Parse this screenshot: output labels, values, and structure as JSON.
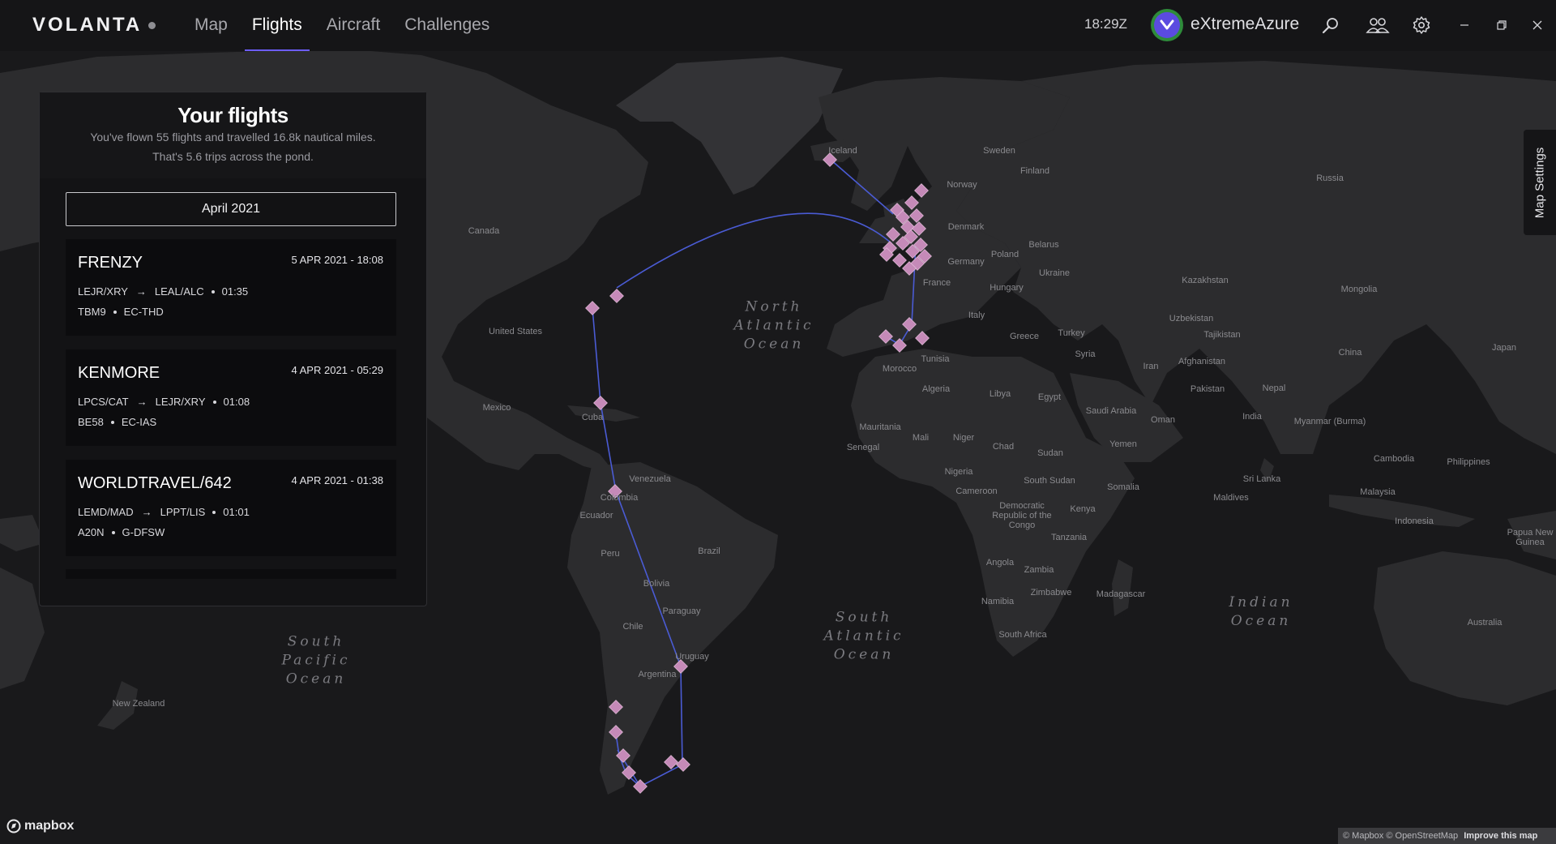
{
  "app": {
    "brand": "VOLANTA",
    "nav": [
      {
        "label": "Map",
        "active": false
      },
      {
        "label": "Flights",
        "active": true
      },
      {
        "label": "Aircraft",
        "active": false
      },
      {
        "label": "Challenges",
        "active": false
      }
    ],
    "utc_time": "18:29Z",
    "username": "eXtremeAzure",
    "icons": {
      "search": "search-icon",
      "friends": "friends-icon",
      "settings": "gear-icon",
      "minimize": "minimize-icon",
      "restore": "restore-icon",
      "close": "close-icon"
    }
  },
  "flights_panel": {
    "title": "Your flights",
    "subtitle_line1": "You've flown 55 flights and travelled 16.8k nautical miles.",
    "subtitle_line2": "That's 5.6 trips across the pond.",
    "month_filter": "April 2021",
    "flights": [
      {
        "callsign": "FRENZY",
        "date": "5 APR 2021 - 18:08",
        "origin": "LEJR/XRY",
        "destination": "LEAL/ALC",
        "duration": "01:35",
        "aircraft_type": "TBM9",
        "registration": "EC-THD"
      },
      {
        "callsign": "KENMORE",
        "date": "4 APR 2021 - 05:29",
        "origin": "LPCS/CAT",
        "destination": "LEJR/XRY",
        "duration": "01:08",
        "aircraft_type": "BE58",
        "registration": "EC-IAS"
      },
      {
        "callsign": "WORLDTRAVEL/642",
        "date": "4 APR 2021 - 01:38",
        "origin": "LEMD/MAD",
        "destination": "LPPT/LIS",
        "duration": "01:01",
        "aircraft_type": "A20N",
        "registration": "G-DFSW"
      }
    ]
  },
  "map": {
    "oceans": [
      {
        "name": "North\nAtlantic\nOcean"
      },
      {
        "name": "South\nAtlantic\nOcean"
      },
      {
        "name": "South\nPacific\nOcean"
      },
      {
        "name": "Indian\nOcean"
      }
    ],
    "labels": [
      "Iceland",
      "Sweden",
      "Finland",
      "Norway",
      "Russia",
      "Canada",
      "Denmark",
      "Belarus",
      "Poland",
      "Ukraine",
      "Germany",
      "France",
      "Hungary",
      "Kazakhstan",
      "Mongolia",
      "United States",
      "Italy",
      "Uzbekistan",
      "Turkey",
      "Greece",
      "Tajikistan",
      "Japan",
      "Syria",
      "Iran",
      "Afghanistan",
      "China",
      "Tunisia",
      "Morocco",
      "Algeria",
      "Libya",
      "Egypt",
      "Saudi Arabia",
      "Pakistan",
      "Nepal",
      "Mexico",
      "Cuba",
      "Oman",
      "India",
      "Myanmar (Burma)",
      "Mauritania",
      "Mali",
      "Niger",
      "Chad",
      "Sudan",
      "Yemen",
      "Senegal",
      "Nigeria",
      "Cambodia",
      "Philippines",
      "Venezuela",
      "Cameroon",
      "South Sudan",
      "Somalia",
      "Sri Lanka",
      "Colombia",
      "Malaysia",
      "Maldives",
      "Ecuador",
      "Democratic Republic of the Congo",
      "Kenya",
      "Indonesia",
      "Papua New Guinea",
      "Brazil",
      "Peru",
      "Tanzania",
      "Angola",
      "Zambia",
      "Bolivia",
      "Madagascar",
      "Namibia",
      "Zimbabwe",
      "Paraguay",
      "South Africa",
      "Australia",
      "Chile",
      "Uruguay",
      "Argentina",
      "New Zealand"
    ],
    "map_settings_label": "Map Settings",
    "logo_text": "mapbox",
    "attribution": "© Mapbox © OpenStreetMap",
    "attribution_link": "Improve this map"
  },
  "colors": {
    "accent": "#6d5dfc",
    "route": "#4a5bd4",
    "airport_marker": "#c58ab8",
    "panel_bg": "#131315",
    "card_bg": "#0c0c0e",
    "land": "#2c2c2e",
    "water": "#19191b"
  }
}
